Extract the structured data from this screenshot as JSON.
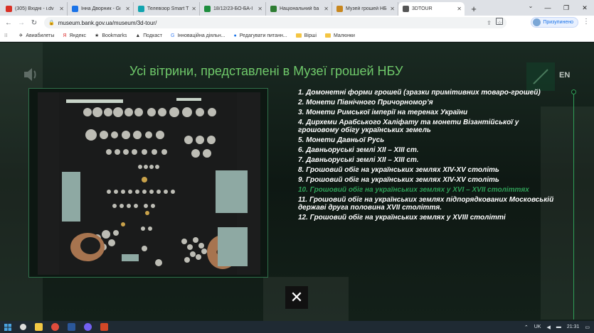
{
  "browser": {
    "tabs": [
      {
        "title": "(305) Вхідні - i.dv",
        "color": "#d93025"
      },
      {
        "title": "Інна Дворник - Gi",
        "color": "#1a73e8"
      },
      {
        "title": "Телевізор Smart T",
        "color": "#12a4af"
      },
      {
        "title": "18/12/23-БО-БА-I",
        "color": "#1e8e3e"
      },
      {
        "title": "Національний ба",
        "color": "#2e7d32"
      },
      {
        "title": "Музей грошей НБ",
        "color": "#c8871e"
      },
      {
        "title": "3DTOUR",
        "color": "#555555"
      }
    ],
    "url": "museum.bank.gov.ua/museum/3d-tour/",
    "profile_label": "Призупинено",
    "bookmarks": [
      "Авиабилеты",
      "Яндекс",
      "Bookmarks",
      "Подкаст",
      "Інноваційна діяльн...",
      "Редагувати питанн...",
      "Вірші",
      "Малюнки"
    ]
  },
  "page": {
    "lang_button": "EN",
    "heading": "Усі вітрини, представлені в Музеї грошей НБУ",
    "showcases": [
      "1. Домонетні форми грошей (зразки примітивних товаро-грошей)",
      "2. Монети Північного Причорномор’я",
      "3. Монети Римської імперії на теренах України",
      "4. Дирхеми Арабського Халіфату та монети Візантійської у грошовому обігу українських земель",
      "5. Монети Давньої Русь",
      "6. Давньоруські землі XII – XIII ст.",
      "7. Давньоруські землі XII – XIII ст.",
      "8. Грошовий обіг на українських землях XIV-XV століть",
      "9. Грошовий обіг на українських землях XIV-XV століть",
      "10. Грошовий обіг на українських землях у XVI – XVII століттях",
      "11. Грошовий обіг на українських землях підпорядкованих Московській державі друга половина XVII століття.",
      "12. Грошовий обіг на українських землях у XVIII столітті"
    ],
    "active_index": 9,
    "close_symbol": "✕",
    "accent_color": "#2f9e57"
  },
  "taskbar": {
    "lang": "UK",
    "time": "21:31"
  }
}
